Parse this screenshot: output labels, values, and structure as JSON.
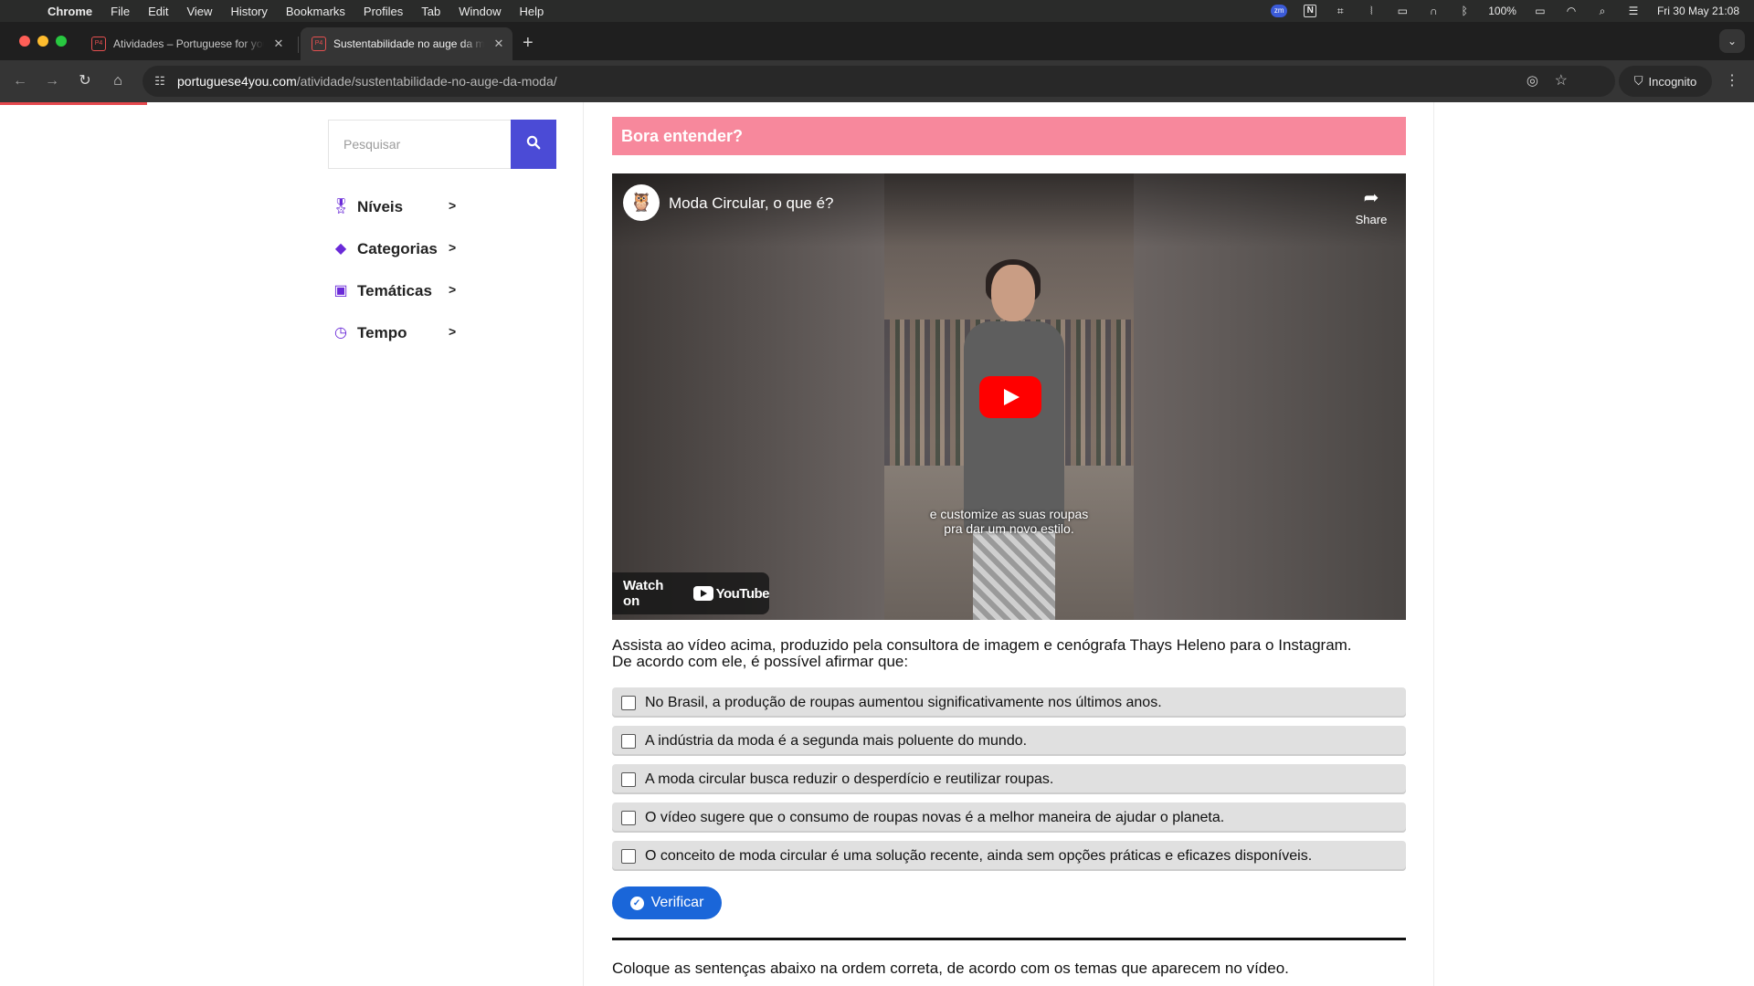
{
  "menubar": {
    "app": "Chrome",
    "items": [
      "File",
      "Edit",
      "View",
      "History",
      "Bookmarks",
      "Profiles",
      "Tab",
      "Window",
      "Help"
    ],
    "battery": "100%",
    "datetime": "Fri 30 May  21:08"
  },
  "tabs": [
    {
      "title": "Atividades – Portuguese for you",
      "active": false
    },
    {
      "title": "Sustentabilidade no auge da moda",
      "active": true
    }
  ],
  "toolbar": {
    "url_host": "portuguese4you.com",
    "url_path": "/atividade/sustentabilidade-no-auge-da-moda/",
    "incognito_label": "Incognito"
  },
  "sidebar": {
    "search_placeholder": "Pesquisar",
    "items": [
      {
        "label": "Níveis",
        "icon": "medal-icon"
      },
      {
        "label": "Categorias",
        "icon": "tags-icon"
      },
      {
        "label": "Temáticas",
        "icon": "book-icon"
      },
      {
        "label": "Tempo",
        "icon": "clock-icon"
      }
    ]
  },
  "content": {
    "banner": "Bora entender?",
    "video": {
      "title": "Moda Circular, o que é?",
      "share_label": "Share",
      "caption_line1": "e customize as suas roupas",
      "caption_line2": "pra dar um novo estilo.",
      "watch_on": "Watch on",
      "youtube": "YouTube"
    },
    "question_line1": "Assista ao vídeo acima, produzido pela consultora de imagem e cenógrafa Thays Heleno para o Instagram.",
    "question_line2": "De acordo com ele, é possível afirmar que:",
    "options": [
      "No Brasil, a produção de roupas aumentou significativamente nos últimos anos.",
      "A indústria da moda é a segunda mais poluente do mundo.",
      "A moda circular busca reduzir o desperdício e reutilizar roupas.",
      "O vídeo sugere que o consumo de roupas novas é a melhor maneira de ajudar o planeta.",
      "O conceito de moda circular é uma solução recente, ainda sem opções práticas e eficazes disponíveis."
    ],
    "verify_label": "Verificar",
    "instruction": "Coloque as sentenças abaixo na ordem correta, de acordo com os temas que aparecem no vídeo."
  },
  "colors": {
    "banner": "#f7889c",
    "search_button": "#4b4bd6",
    "verify_button": "#1a66d9",
    "nav_icon": "#6a2ad8",
    "youtube_red": "#ff0000"
  }
}
